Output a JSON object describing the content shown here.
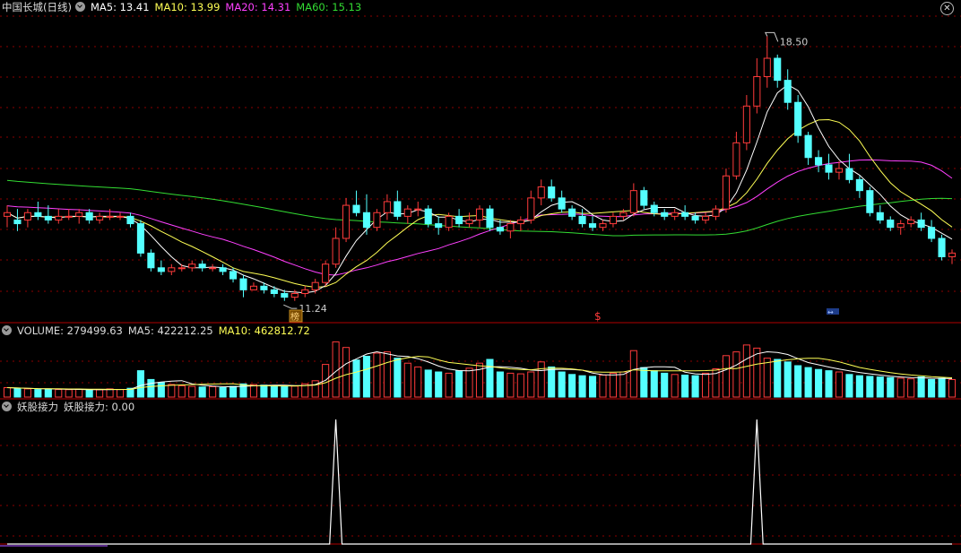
{
  "price_header": {
    "title": "中国长城(日线)",
    "ma5": "MA5: 13.41",
    "ma10": "MA10: 13.99",
    "ma20": "MA20: 14.31",
    "ma60": "MA60: 15.13"
  },
  "volume_header": {
    "title": "VOLUME: 279499.63",
    "ma5": "MA5: 422212.25",
    "ma10": "MA10: 462812.72"
  },
  "indicator_header": {
    "title": "妖股接力",
    "value": "妖股接力: 0.00"
  },
  "annotations": {
    "high_label": "18.50",
    "low_label": "11.24",
    "marker_bang": "榜",
    "marker_s": "$",
    "marker_arrow": "↔"
  },
  "colors": {
    "up": "#ff3b3b",
    "down": "#54ffff",
    "ma5": "#ffffff",
    "ma10": "#ffff55",
    "ma20": "#ff40ff",
    "ma60": "#33dd33",
    "grid": "#8b0000",
    "separator": "#b00000"
  },
  "chart_data": [
    {
      "type": "candlestick",
      "title": "中国长城(日线)",
      "ylim": [
        11.0,
        18.9
      ],
      "ohlc": [
        [
          13.6,
          13.9,
          13.3,
          13.7
        ],
        [
          13.5,
          13.8,
          13.2,
          13.4
        ],
        [
          13.5,
          13.8,
          13.3,
          13.7
        ],
        [
          13.7,
          14.0,
          13.5,
          13.6
        ],
        [
          13.6,
          13.9,
          13.4,
          13.5
        ],
        [
          13.5,
          13.8,
          13.4,
          13.6
        ],
        [
          13.6,
          13.8,
          13.5,
          13.6
        ],
        [
          13.6,
          13.8,
          13.4,
          13.7
        ],
        [
          13.7,
          13.8,
          13.4,
          13.5
        ],
        [
          13.5,
          13.7,
          13.4,
          13.6
        ],
        [
          13.6,
          13.8,
          13.5,
          13.6
        ],
        [
          13.6,
          13.7,
          13.5,
          13.6
        ],
        [
          13.6,
          13.7,
          13.3,
          13.4
        ],
        [
          13.4,
          13.5,
          12.5,
          12.6
        ],
        [
          12.6,
          12.7,
          12.1,
          12.2
        ],
        [
          12.2,
          12.4,
          12.0,
          12.1
        ],
        [
          12.1,
          12.3,
          12.0,
          12.2
        ],
        [
          12.2,
          12.3,
          12.1,
          12.2
        ],
        [
          12.2,
          12.4,
          12.1,
          12.3
        ],
        [
          12.3,
          12.4,
          12.1,
          12.2
        ],
        [
          12.2,
          12.3,
          12.1,
          12.2
        ],
        [
          12.2,
          12.3,
          12.0,
          12.1
        ],
        [
          12.1,
          12.2,
          11.8,
          11.9
        ],
        [
          11.9,
          12.0,
          11.4,
          11.6
        ],
        [
          11.6,
          11.8,
          11.6,
          11.7
        ],
        [
          11.7,
          11.8,
          11.5,
          11.6
        ],
        [
          11.6,
          11.7,
          11.4,
          11.5
        ],
        [
          11.5,
          11.6,
          11.3,
          11.4
        ],
        [
          11.4,
          11.6,
          11.3,
          11.5
        ],
        [
          11.5,
          11.7,
          11.4,
          11.6
        ],
        [
          11.6,
          11.9,
          11.5,
          11.8
        ],
        [
          11.8,
          12.4,
          11.7,
          12.3
        ],
        [
          12.3,
          13.3,
          12.2,
          13.0
        ],
        [
          13.0,
          14.1,
          12.9,
          13.9
        ],
        [
          13.9,
          14.3,
          13.6,
          13.7
        ],
        [
          13.7,
          14.2,
          13.1,
          13.3
        ],
        [
          13.3,
          13.8,
          13.2,
          13.7
        ],
        [
          13.7,
          14.2,
          13.5,
          14.0
        ],
        [
          14.0,
          14.3,
          13.5,
          13.6
        ],
        [
          13.6,
          13.9,
          13.4,
          13.8
        ],
        [
          13.8,
          14.0,
          13.6,
          13.8
        ],
        [
          13.8,
          13.9,
          13.3,
          13.4
        ],
        [
          13.4,
          13.6,
          13.1,
          13.3
        ],
        [
          13.3,
          13.7,
          13.2,
          13.6
        ],
        [
          13.6,
          13.8,
          13.3,
          13.4
        ],
        [
          13.4,
          13.7,
          13.3,
          13.5
        ],
        [
          13.5,
          13.9,
          13.3,
          13.8
        ],
        [
          13.8,
          13.9,
          13.2,
          13.3
        ],
        [
          13.3,
          13.5,
          13.1,
          13.2
        ],
        [
          13.2,
          13.5,
          13.0,
          13.4
        ],
        [
          13.4,
          13.6,
          13.2,
          13.5
        ],
        [
          13.5,
          14.3,
          13.4,
          14.1
        ],
        [
          14.1,
          14.6,
          13.9,
          14.4
        ],
        [
          14.4,
          14.6,
          14.0,
          14.1
        ],
        [
          14.1,
          14.3,
          13.7,
          13.8
        ],
        [
          13.8,
          13.9,
          13.5,
          13.6
        ],
        [
          13.6,
          13.8,
          13.3,
          13.4
        ],
        [
          13.4,
          13.6,
          13.2,
          13.3
        ],
        [
          13.3,
          13.5,
          13.2,
          13.4
        ],
        [
          13.4,
          13.7,
          13.3,
          13.6
        ],
        [
          13.6,
          13.8,
          13.5,
          13.7
        ],
        [
          13.7,
          14.5,
          13.6,
          14.3
        ],
        [
          14.3,
          14.4,
          13.8,
          13.9
        ],
        [
          13.9,
          14.0,
          13.6,
          13.7
        ],
        [
          13.7,
          13.8,
          13.5,
          13.6
        ],
        [
          13.6,
          13.8,
          13.5,
          13.7
        ],
        [
          13.7,
          13.9,
          13.5,
          13.6
        ],
        [
          13.6,
          13.7,
          13.4,
          13.5
        ],
        [
          13.5,
          13.7,
          13.4,
          13.6
        ],
        [
          13.6,
          13.9,
          13.5,
          13.8
        ],
        [
          13.8,
          14.9,
          13.7,
          14.7
        ],
        [
          14.7,
          15.9,
          14.6,
          15.6
        ],
        [
          15.6,
          16.9,
          15.4,
          16.6
        ],
        [
          16.6,
          17.9,
          16.4,
          17.4
        ],
        [
          17.4,
          18.5,
          17.1,
          17.9
        ],
        [
          17.9,
          18.0,
          17.1,
          17.3
        ],
        [
          17.3,
          17.6,
          16.5,
          16.7
        ],
        [
          16.7,
          16.9,
          15.6,
          15.8
        ],
        [
          15.8,
          15.9,
          15.0,
          15.2
        ],
        [
          15.2,
          15.4,
          14.8,
          15.0
        ],
        [
          15.0,
          15.3,
          14.6,
          14.8
        ],
        [
          14.8,
          15.1,
          14.6,
          14.9
        ],
        [
          14.9,
          15.3,
          14.5,
          14.6
        ],
        [
          14.6,
          14.7,
          14.1,
          14.3
        ],
        [
          14.3,
          14.4,
          13.6,
          13.7
        ],
        [
          13.7,
          13.9,
          13.4,
          13.5
        ],
        [
          13.5,
          13.6,
          13.2,
          13.3
        ],
        [
          13.3,
          13.5,
          13.1,
          13.4
        ],
        [
          13.4,
          13.6,
          13.3,
          13.5
        ],
        [
          13.5,
          13.7,
          13.2,
          13.3
        ],
        [
          13.3,
          13.5,
          12.9,
          13.0
        ],
        [
          13.0,
          13.1,
          12.4,
          12.5
        ],
        [
          12.5,
          12.7,
          12.3,
          12.6
        ]
      ],
      "annotations": [
        {
          "text": "18.50",
          "x": 74,
          "y": 18.5
        },
        {
          "text": "11.24",
          "x": 27,
          "y": 11.24
        }
      ]
    },
    {
      "type": "bar",
      "title": "VOLUME",
      "values": [
        150000,
        140000,
        130000,
        120000,
        125000,
        120000,
        118000,
        122000,
        110000,
        115000,
        130000,
        120000,
        140000,
        420000,
        280000,
        230000,
        200000,
        180000,
        170000,
        160000,
        165000,
        150000,
        170000,
        210000,
        200000,
        190000,
        180000,
        170000,
        175000,
        210000,
        260000,
        520000,
        880000,
        790000,
        590000,
        650000,
        700000,
        720000,
        620000,
        540000,
        480000,
        430000,
        400000,
        380000,
        420000,
        460000,
        540000,
        600000,
        400000,
        380000,
        370000,
        400000,
        560000,
        480000,
        400000,
        360000,
        340000,
        330000,
        350000,
        380000,
        400000,
        740000,
        470000,
        420000,
        380000,
        360000,
        350000,
        340000,
        380000,
        450000,
        660000,
        720000,
        830000,
        780000,
        620000,
        600000,
        560000,
        500000,
        470000,
        440000,
        420000,
        400000,
        360000,
        340000,
        330000,
        320000,
        310000,
        300000,
        290000,
        320000,
        280000,
        300000,
        279499.63
      ]
    },
    {
      "type": "line",
      "title": "妖股接力",
      "ylim": [
        0,
        1
      ],
      "values": [
        0,
        0,
        0,
        0,
        0,
        0,
        0,
        0,
        0,
        0,
        0,
        0,
        0,
        0,
        0,
        0,
        0,
        0,
        0,
        0,
        0,
        0,
        0,
        0,
        0,
        0,
        0,
        0,
        0,
        0,
        0,
        0,
        1,
        0,
        0,
        0,
        0,
        0,
        0,
        0,
        0,
        0,
        0,
        0,
        0,
        0,
        0,
        0,
        0,
        0,
        0,
        0,
        0,
        0,
        0,
        0,
        0,
        0,
        0,
        0,
        0,
        0,
        0,
        0,
        0,
        0,
        0,
        0,
        0,
        0,
        0,
        0,
        0,
        1,
        0,
        0,
        0,
        0,
        0,
        0,
        0,
        0,
        0,
        0,
        0,
        0,
        0,
        0,
        0,
        0,
        0,
        0,
        0
      ]
    }
  ]
}
